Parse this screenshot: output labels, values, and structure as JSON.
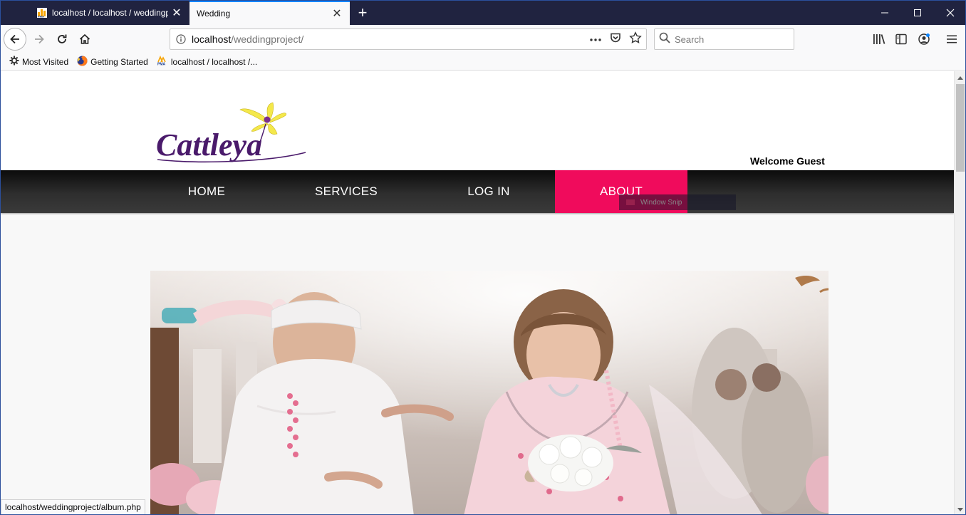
{
  "browser": {
    "tabs": [
      {
        "title": "localhost / localhost / weddingpro",
        "icon": "phpmyadmin-icon",
        "active": false
      },
      {
        "title": "Wedding",
        "icon": "none",
        "active": true
      }
    ],
    "url_host": "localhost",
    "url_path": "/weddingproject/",
    "search_placeholder": "Search",
    "bookmarks": [
      {
        "label": "Most Visited",
        "icon": "gear-icon"
      },
      {
        "label": "Getting Started",
        "icon": "firefox-icon"
      },
      {
        "label": "localhost / localhost /...",
        "icon": "phpmyadmin-icon"
      }
    ],
    "status_url": "localhost/weddingproject/album.php"
  },
  "site": {
    "logo_text": "Cattleya",
    "welcome": "Welcome Guest",
    "nav": {
      "home": "HOME",
      "services": "SERVICES",
      "login": "LOG IN",
      "about": "ABOUT"
    },
    "snip_label": "Window Snip",
    "colors": {
      "accent": "#f00b5c",
      "navbar": "#1a1a1a",
      "logo": "#4a1a6b",
      "logo_flower": "#f4e84a"
    }
  }
}
